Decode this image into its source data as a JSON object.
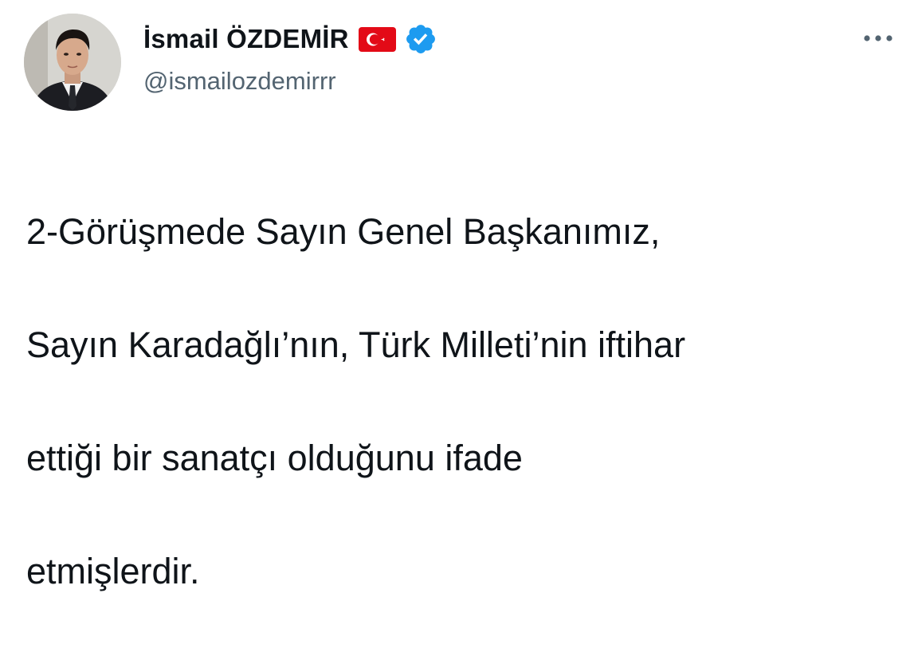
{
  "tweet": {
    "author": {
      "display_name": "İsmail ÖZDEMİR",
      "handle": "@ismailozdemirrr",
      "verified": true,
      "badges": [
        "turkey-flag-icon",
        "verified-badge-icon"
      ]
    },
    "text_lines": [
      "2-Görüşmede Sayın Genel Başkanımız,",
      "Sayın Karadağlı’nın, Türk Milleti’nin iftihar",
      "ettiği bir sanatçı olduğunu ifade",
      "etmişlerdir."
    ],
    "menu_icon": "more-horizontal-icon"
  },
  "colors": {
    "text_primary": "#0f1419",
    "text_secondary": "#536471",
    "verified_blue": "#1d9bf0",
    "flag_red": "#e30a17"
  }
}
